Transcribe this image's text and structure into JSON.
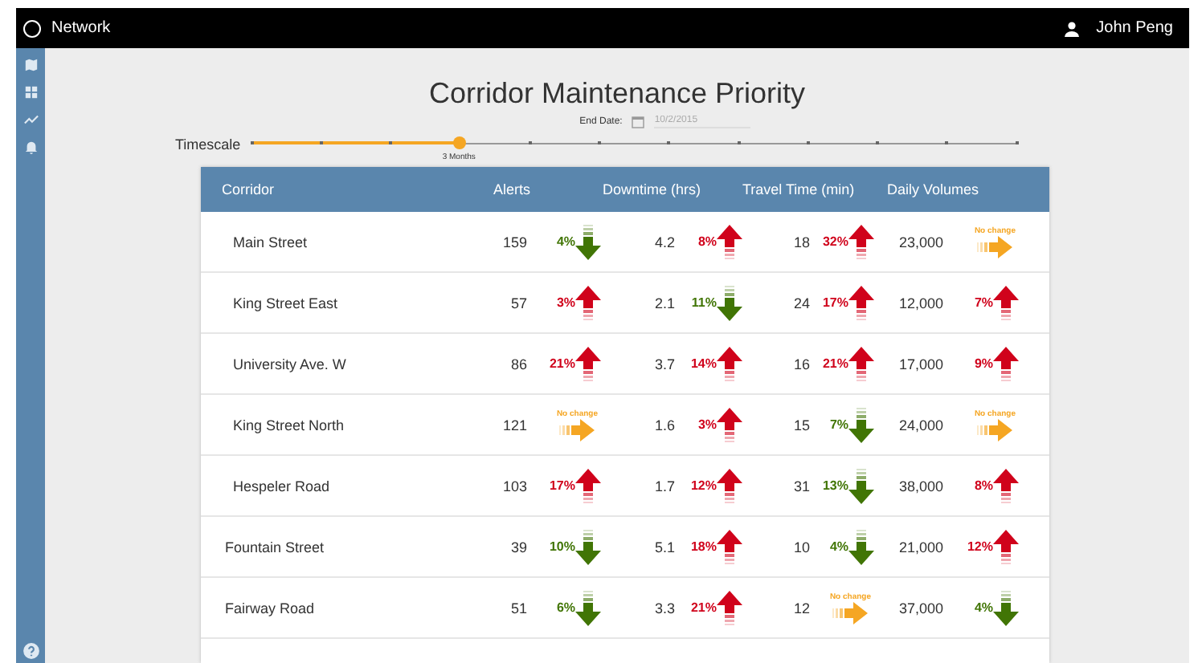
{
  "app_bar": {
    "title": "Network",
    "user": "John Peng"
  },
  "sidebar": {
    "items": [
      {
        "kind": "map"
      },
      {
        "kind": "grid"
      },
      {
        "kind": "trend"
      },
      {
        "kind": "bell"
      }
    ],
    "help": {
      "kind": "help"
    }
  },
  "page": {
    "title": "Corridor Maintenance Priority",
    "end_date": {
      "label": "End Date:",
      "placeholder": "10/2/2015"
    }
  },
  "timescale": {
    "label": "Timescale",
    "level": 0.273,
    "reading": "3 Months"
  },
  "table": {
    "columns": [
      "Corridor",
      "Alerts",
      "Downtime (hrs)",
      "Travel Time (min)",
      "Daily Volumes"
    ],
    "rows": [
      {
        "corridor": "Main Street",
        "metrics": [
          {
            "value": "159",
            "change": {
              "kind": "down",
              "text": "4%"
            }
          },
          {
            "value": "4.2",
            "change": {
              "kind": "up",
              "text": "8%"
            }
          },
          {
            "value": "18",
            "change": {
              "kind": "up",
              "text": "32%"
            }
          },
          {
            "value": "23,000",
            "change": {
              "kind": "none",
              "text": "No change"
            }
          }
        ]
      },
      {
        "corridor": "King Street East",
        "metrics": [
          {
            "value": "57",
            "change": {
              "kind": "up",
              "text": "3%"
            }
          },
          {
            "value": "2.1",
            "change": {
              "kind": "down",
              "text": "11%"
            }
          },
          {
            "value": "24",
            "change": {
              "kind": "up",
              "text": "17%"
            }
          },
          {
            "value": "12,000",
            "change": {
              "kind": "up",
              "text": "7%"
            }
          }
        ]
      },
      {
        "corridor": "University Ave. W",
        "metrics": [
          {
            "value": "86",
            "change": {
              "kind": "up",
              "text": "21%"
            }
          },
          {
            "value": "3.7",
            "change": {
              "kind": "up",
              "text": "14%"
            }
          },
          {
            "value": "16",
            "change": {
              "kind": "up",
              "text": "21%"
            }
          },
          {
            "value": "17,000",
            "change": {
              "kind": "up",
              "text": "9%"
            }
          }
        ]
      },
      {
        "corridor": "King Street North",
        "metrics": [
          {
            "value": "121",
            "change": {
              "kind": "none",
              "text": "No change"
            }
          },
          {
            "value": "1.6",
            "change": {
              "kind": "up",
              "text": "3%"
            }
          },
          {
            "value": "15",
            "change": {
              "kind": "down",
              "text": "7%"
            }
          },
          {
            "value": "24,000",
            "change": {
              "kind": "none",
              "text": "No change"
            }
          }
        ]
      },
      {
        "corridor": "Hespeler Road",
        "metrics": [
          {
            "value": "103",
            "change": {
              "kind": "up",
              "text": "17%"
            }
          },
          {
            "value": "1.7",
            "change": {
              "kind": "up",
              "text": "12%"
            }
          },
          {
            "value": "31",
            "change": {
              "kind": "down",
              "text": "13%"
            }
          },
          {
            "value": "38,000",
            "change": {
              "kind": "up",
              "text": "8%"
            }
          }
        ]
      },
      {
        "corridor": "Fountain Street",
        "metrics": [
          {
            "value": "39",
            "change": {
              "kind": "down",
              "text": "10%"
            }
          },
          {
            "value": "5.1",
            "change": {
              "kind": "up",
              "text": "18%"
            }
          },
          {
            "value": "10",
            "change": {
              "kind": "down",
              "text": "4%"
            }
          },
          {
            "value": "21,000",
            "change": {
              "kind": "up",
              "text": "12%"
            }
          }
        ]
      },
      {
        "corridor": "Fairway Road",
        "metrics": [
          {
            "value": "51",
            "change": {
              "kind": "down",
              "text": "6%"
            }
          },
          {
            "value": "3.3",
            "change": {
              "kind": "up",
              "text": "21%"
            }
          },
          {
            "value": "12",
            "change": {
              "kind": "none",
              "text": "No change"
            }
          },
          {
            "value": "37,000",
            "change": {
              "kind": "down",
              "text": "4%"
            }
          }
        ]
      }
    ]
  }
}
